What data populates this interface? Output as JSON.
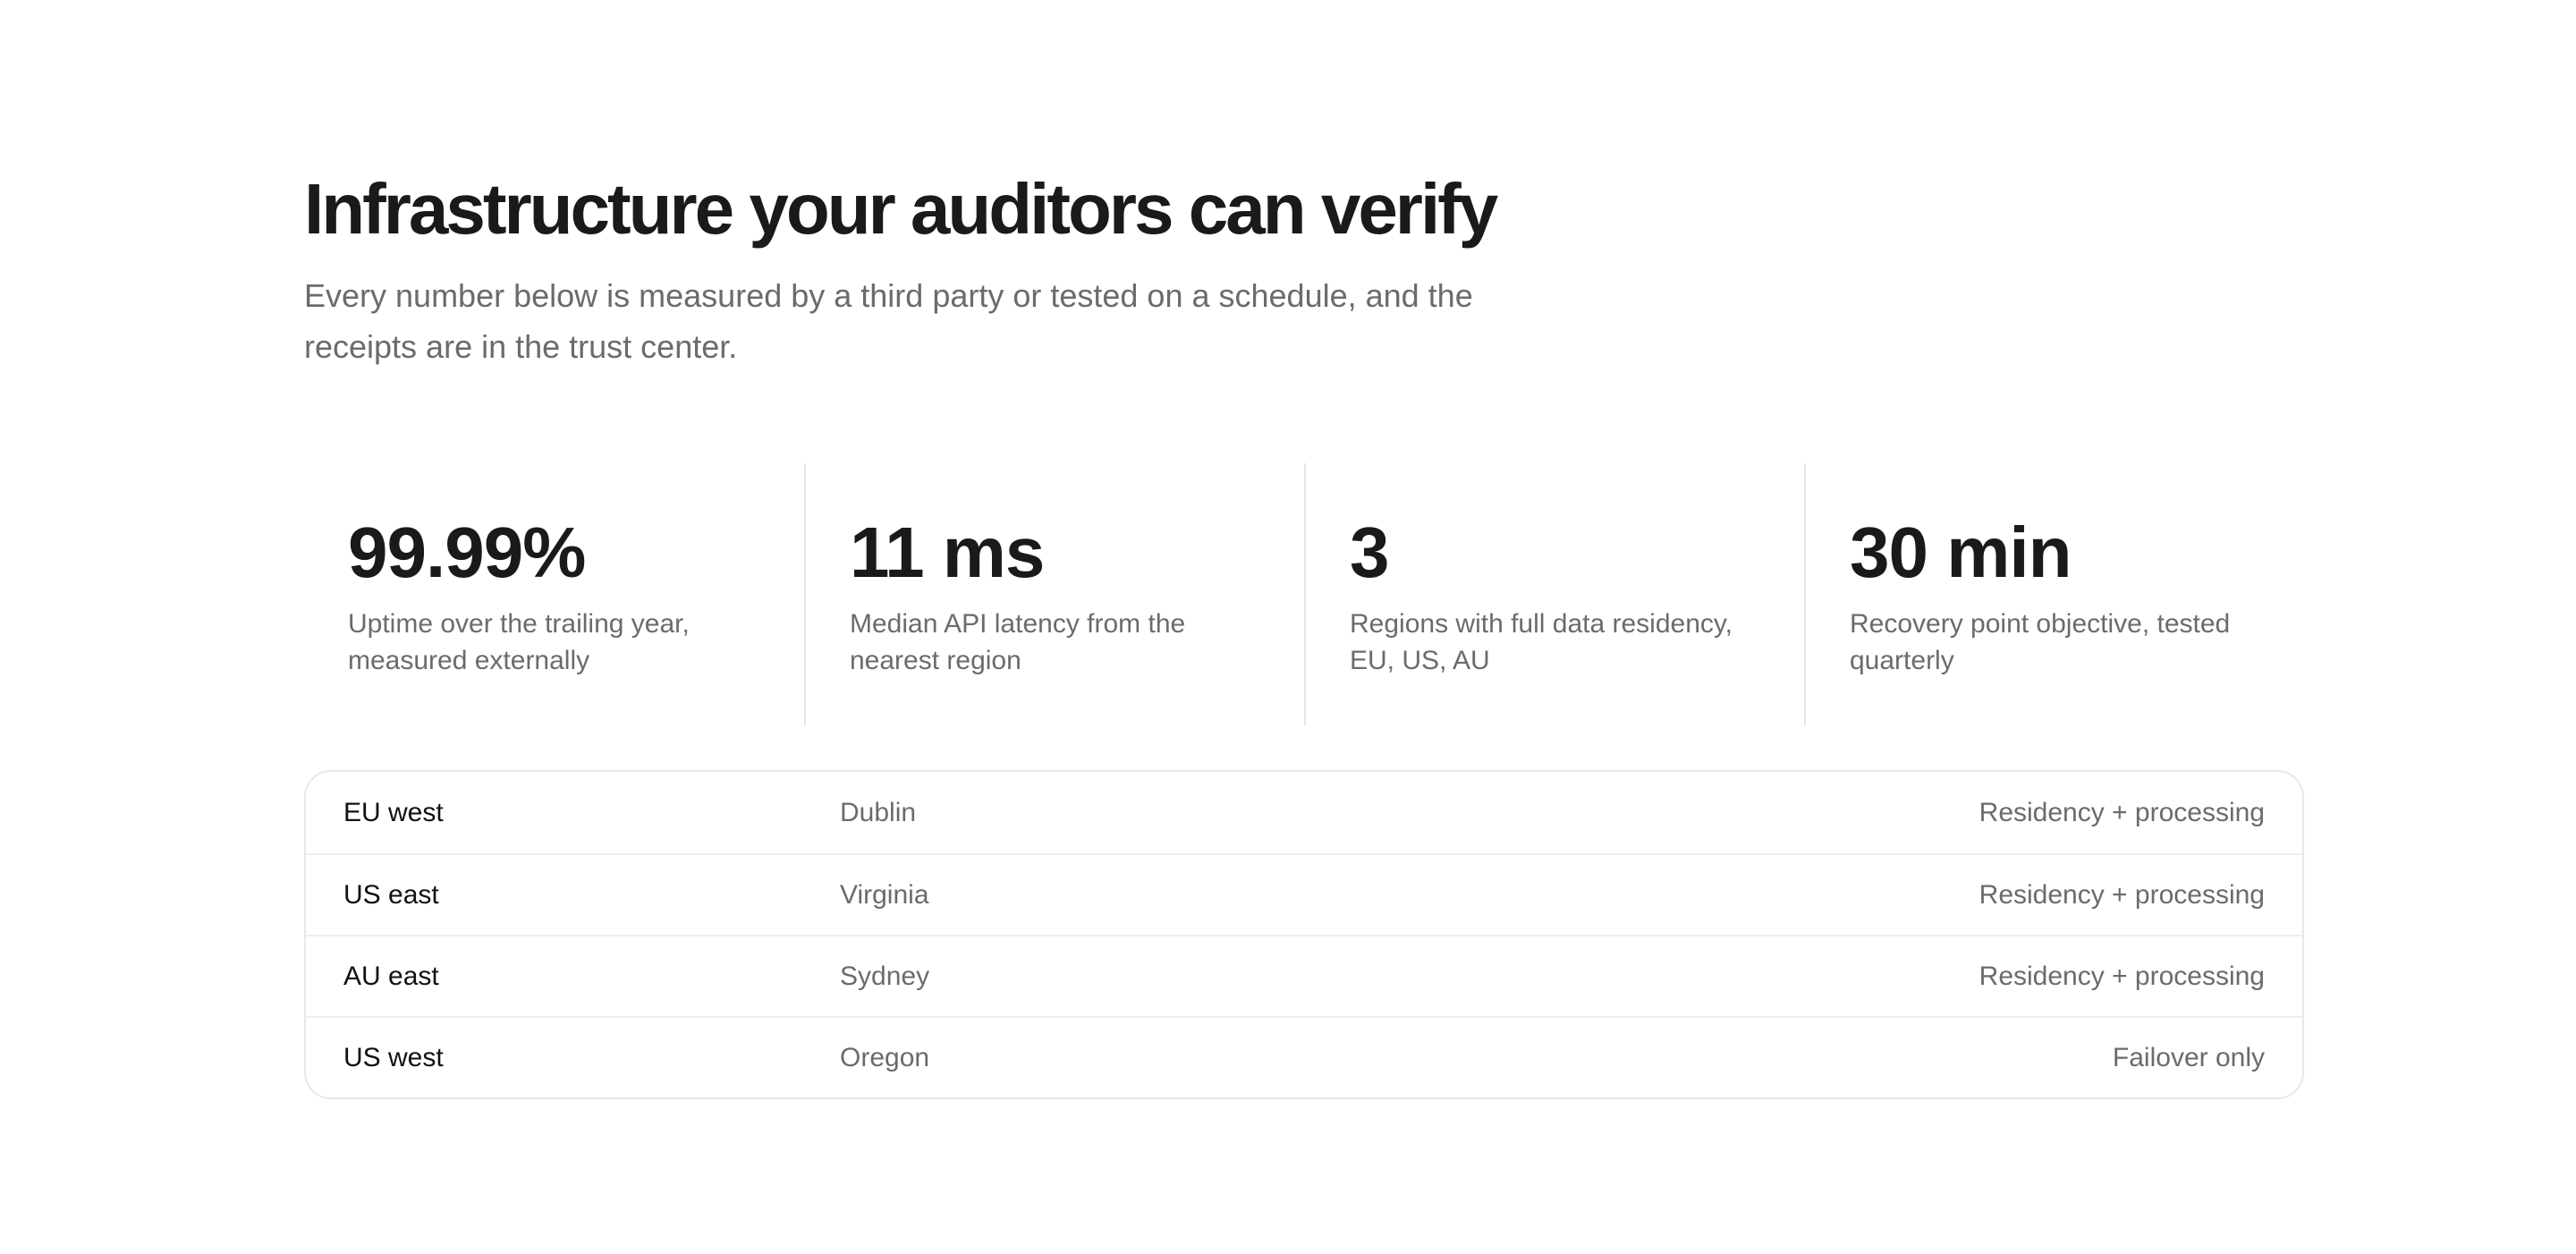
{
  "header": {
    "title": "Infrastructure your auditors can verify",
    "subtitle": "Every number below is measured by a third party or tested on a schedule, and the receipts are in the trust center."
  },
  "stats": [
    {
      "value": "99.99%",
      "label": "Uptime over the trailing year, measured externally"
    },
    {
      "value": "11 ms",
      "label": "Median API latency from the nearest region"
    },
    {
      "value": "3",
      "label": "Regions with full data residency, EU, US, AU"
    },
    {
      "value": "30 min",
      "label": "Recovery point objective, tested quarterly"
    }
  ],
  "regions": [
    {
      "name": "EU west",
      "city": "Dublin",
      "mode": "Residency + processing"
    },
    {
      "name": "US east",
      "city": "Virginia",
      "mode": "Residency + processing"
    },
    {
      "name": "AU east",
      "city": "Sydney",
      "mode": "Residency + processing"
    },
    {
      "name": "US west",
      "city": "Oregon",
      "mode": "Failover only"
    }
  ],
  "colors": {
    "text_primary": "#1a1a1a",
    "text_muted": "#6b6b6b",
    "divider": "#e6e6e6",
    "background": "#ffffff"
  }
}
